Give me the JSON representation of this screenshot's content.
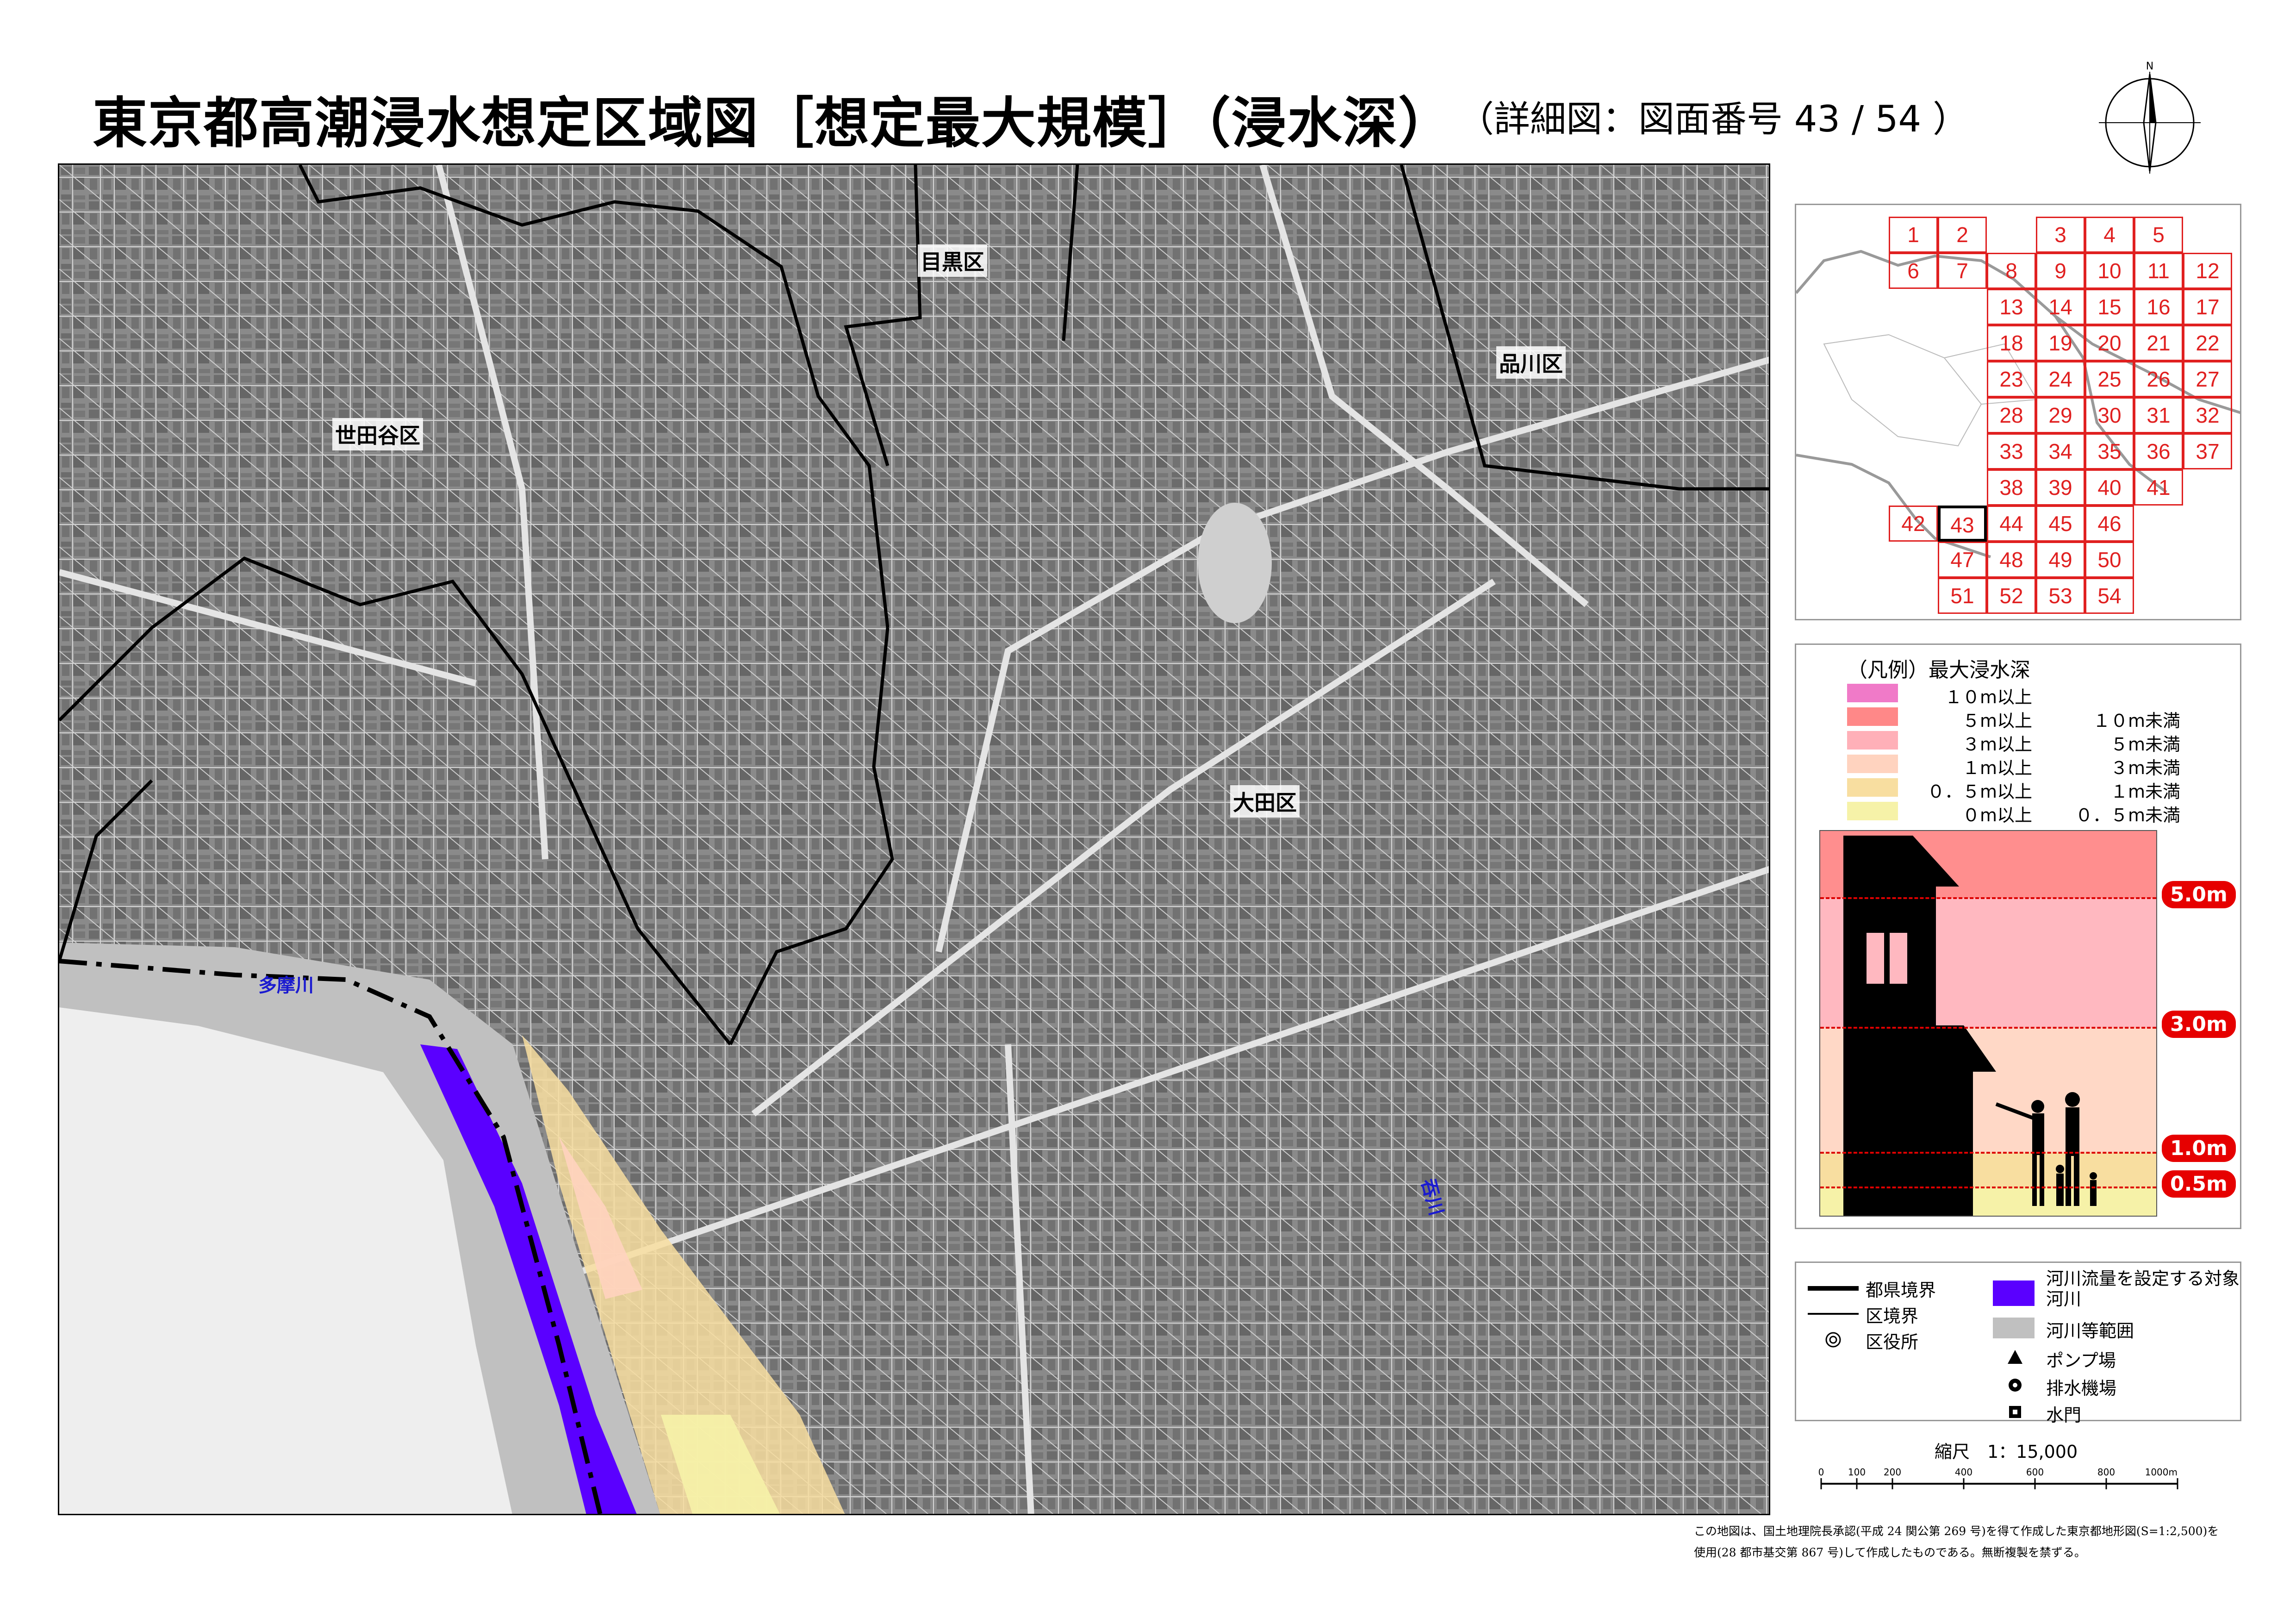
{
  "title": "東京都高潮浸水想定区域図［想定最大規模］（浸水深）",
  "subtitle": "（詳細図：図面番号 43 / 54 ）",
  "compass": {
    "north": "N"
  },
  "map": {
    "wards": [
      {
        "name": "世田谷区"
      },
      {
        "name": "目黒区"
      },
      {
        "name": "品川区"
      },
      {
        "name": "大田区"
      }
    ],
    "rivers": [
      {
        "name": "多摩川"
      },
      {
        "name": "吞川"
      }
    ]
  },
  "index_map": {
    "current_sheet": 43,
    "sheets": [
      1,
      2,
      3,
      4,
      5,
      6,
      7,
      8,
      9,
      10,
      11,
      12,
      13,
      14,
      15,
      16,
      17,
      18,
      19,
      20,
      21,
      22,
      23,
      24,
      25,
      26,
      27,
      28,
      29,
      30,
      31,
      32,
      33,
      34,
      35,
      36,
      37,
      38,
      39,
      40,
      41,
      42,
      43,
      44,
      45,
      46,
      47,
      48,
      49,
      50,
      51,
      52,
      53,
      54
    ]
  },
  "legend": {
    "title": "（凡例）最大浸水深",
    "classes": [
      {
        "from": "１０m以上",
        "to": "",
        "color": "#f07ac8"
      },
      {
        "from": "５m以上",
        "to": "１０m未満",
        "color": "#ff8888"
      },
      {
        "from": "３m以上",
        "to": "５m未満",
        "color": "#ffb0b8"
      },
      {
        "from": "１m以上",
        "to": "３m未満",
        "color": "#ffd3bf"
      },
      {
        "from": "０．５m以上",
        "to": "１m未満",
        "color": "#f8dea0"
      },
      {
        "from": "０m以上",
        "to": "０．５m未満",
        "color": "#f6f2a8"
      }
    ],
    "depth_markers": [
      "5.0m",
      "3.0m",
      "1.0m",
      "0.5m"
    ]
  },
  "symbols": {
    "prefecture_boundary": "都県境界",
    "ward_boundary": "区境界",
    "ward_office": "区役所",
    "target_river": "河川流量を設定する対象河川",
    "river_area": "河川等範囲",
    "pump_station": "ポンプ場",
    "drainage_station": "排水機場",
    "sluice_gate": "水門",
    "icons": {
      "ward_office": "double-circle-icon",
      "pump_station": "triangle-icon",
      "drainage_station": "dot-circle-icon",
      "sluice_gate": "square-icon"
    },
    "colors": {
      "target_river": "#5a00ff",
      "river_area": "#c0c0c0"
    }
  },
  "scale": {
    "label": "縮尺　1：15,000",
    "ticks": [
      "0",
      "100",
      "200",
      "400",
      "600",
      "800",
      "1000m"
    ]
  },
  "credit": {
    "line1": "この地図は、国土地理院長承認(平成 24 関公第 269 号)を得て作成した東京都地形図(S=1:2,500)を",
    "line2": "使用(28 都市基交第 867 号)して作成したものである。無断複製を禁ずる。"
  }
}
